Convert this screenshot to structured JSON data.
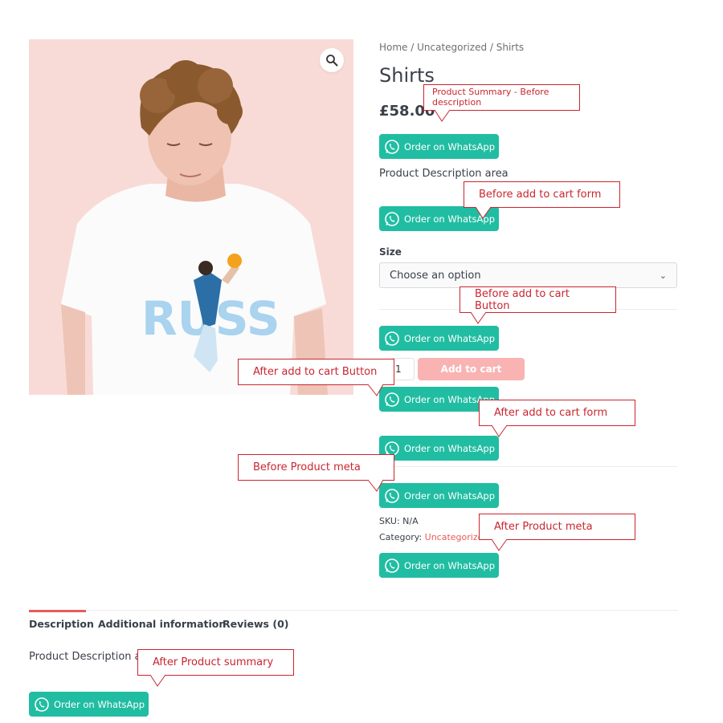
{
  "breadcrumb": {
    "home": "Home",
    "sep1": " / ",
    "category": "Uncategorized",
    "sep2": " / ",
    "current": "Shirts"
  },
  "product": {
    "title": "Shirts",
    "price": "£58.00",
    "description_area": "Product Description area",
    "size_label": "Size",
    "size_select_value": "Choose an option",
    "quantity": "1",
    "add_to_cart": "Add to cart",
    "sku": "SKU: N/A",
    "category_label": "Category: ",
    "category_value": "Uncategorized",
    "shirt_text": "RUSS"
  },
  "whatsapp_label": "Order on WhatsApp",
  "tabs": [
    {
      "label": "Description",
      "active": true
    },
    {
      "label": "Additional information",
      "active": false
    },
    {
      "label": "Reviews (0)",
      "active": false
    }
  ],
  "tab_content": {
    "text": "Product Description area"
  },
  "annotations": {
    "summary_before_desc": "Product Summary - Before description",
    "before_form": "Before add to cart form",
    "before_button": "Before add to cart Button",
    "after_button": "After add to cart Button",
    "after_form": "After add to cart form",
    "before_meta": "Before Product meta",
    "after_meta": "After Product meta",
    "after_summary": "After Product summary"
  },
  "colors": {
    "whatsapp": "#21bda2",
    "accent": "#e95a5a",
    "annotation": "#c9262f",
    "add_to_cart": "#f9b3b3"
  },
  "icons": {
    "zoom": "magnifier-icon",
    "whatsapp": "whatsapp-icon",
    "select": "chevron-down-icon"
  }
}
